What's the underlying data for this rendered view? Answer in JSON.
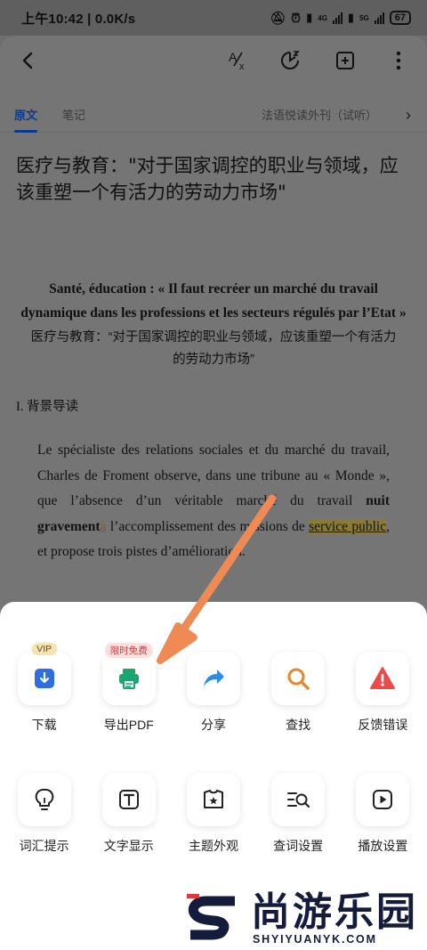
{
  "status_bar": {
    "left": "上午10:42 | 0.0K/s",
    "network_4g": "4G",
    "network_5g": "5G",
    "battery": "67"
  },
  "toolbar": {
    "back_icon": "chevron-left-icon",
    "translate_icon": "translate-icon",
    "timer_icon": "timer-icon",
    "add_icon": "add-box-icon",
    "more_icon": "more-vertical-icon"
  },
  "tabs": {
    "original": "原文",
    "notes": "笔记",
    "source": "法语悦读外刊（试听）"
  },
  "article": {
    "title": "医疗与教育：\"对于国家调控的职业与领域，应该重塑一个有活力的劳动力市场\"",
    "fr_heading": "Santé, éducation : « Il faut recréer un marché du travail dynamique dans les professions et les secteurs régulés par l’Etat »",
    "zh_heading": "医疗与教育：“对于国家调控的职业与领域，应该重塑一个有活力的劳动力市场”",
    "section": "I. 背景导读",
    "para_1": "Le spécialiste des relations sociales et du marché du travail, Charles de Froment observe, dans une tribune au « Monde », que l’absence d’un véritable marché du travail ",
    "para_bold": "nuit gravement",
    "para_hl_a": "à",
    "para_2": " l’accomplissement des missions de ",
    "para_hl_service": "service public",
    "para_3": ", et propose trois pistes d’amélioration."
  },
  "sheet": {
    "row1": [
      {
        "label": "下载",
        "icon": "download-icon",
        "badge": "VIP"
      },
      {
        "label": "导出PDF",
        "icon": "printer-icon",
        "badge": "限时免费"
      },
      {
        "label": "分享",
        "icon": "share-arrow-icon",
        "badge": ""
      },
      {
        "label": "查找",
        "icon": "search-icon",
        "badge": ""
      },
      {
        "label": "反馈错误",
        "icon": "warning-icon",
        "badge": ""
      }
    ],
    "row2": [
      {
        "label": "词汇提示",
        "icon": "lightbulb-icon"
      },
      {
        "label": "文字显示",
        "icon": "text-box-icon"
      },
      {
        "label": "主题外观",
        "icon": "theme-shirt-icon"
      },
      {
        "label": "查词设置",
        "icon": "lookup-settings-icon"
      },
      {
        "label": "播放设置",
        "icon": "play-icon"
      }
    ]
  },
  "watermark": {
    "logo_text": "尚游乐园",
    "domain": "SHYIYUANYK.COM"
  },
  "colors": {
    "accent": "#0b3a8a",
    "arrow": "#f08a55",
    "download_blue": "#2d6fe0",
    "pdf_green": "#1aa66e",
    "share_blue": "#2b8de3",
    "search_orange": "#e6862e",
    "warning_red": "#ea4a4a"
  }
}
